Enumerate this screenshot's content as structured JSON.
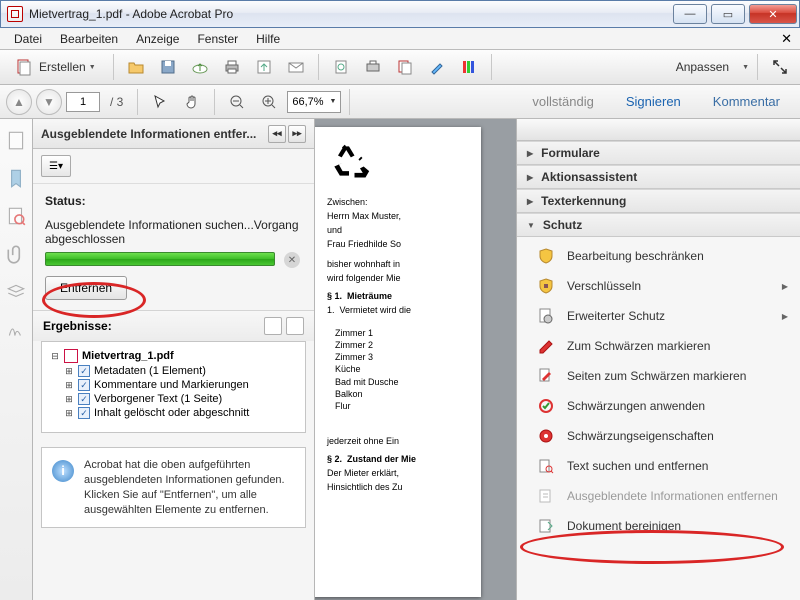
{
  "window": {
    "title": "Mietvertrag_1.pdf - Adobe Acrobat Pro"
  },
  "menu": {
    "datei": "Datei",
    "bearbeiten": "Bearbeiten",
    "anzeige": "Anzeige",
    "fenster": "Fenster",
    "hilfe": "Hilfe"
  },
  "toolbar": {
    "erstellen": "Erstellen",
    "anpassen": "Anpassen"
  },
  "nav": {
    "page": "1",
    "total": "/ 3",
    "zoom": "66,7%"
  },
  "tabs": {
    "voll": "vollständig",
    "sign": "Signieren",
    "komm": "Kommentar"
  },
  "panel": {
    "title": "Ausgeblendete Informationen entfer...",
    "status_h": "Status:",
    "status_txt": "Ausgeblendete Informationen suchen...Vorgang abgeschlossen",
    "entfernen": "Entfernen",
    "erg": "Ergebnisse:",
    "file": "Mietvertrag_1.pdf",
    "r1": "Metadaten (1 Element)",
    "r2": "Kommentare und Markierungen",
    "r3": "Verborgener Text (1 Seite)",
    "r4": "Inhalt gelöscht oder abgeschnitt",
    "info": "Acrobat hat die oben aufgeführten ausgeblendeten Informationen gefunden. Klicken Sie auf \"Entfernen\", um alle ausgewählten Elemente zu entfernen."
  },
  "doc": {
    "zw": "Zwischen:",
    "p1": "Herrn Max Muster,",
    "und": "und",
    "p2": " Frau Friedhilde So",
    "p3": "bisher wohnhaft in",
    "p4": "wird folgender Mie",
    "s1": "§ 1.",
    "s1t": "Mieträume",
    "s1n": "1.",
    "s1x": "Vermietet wird die",
    "z1": "Zimmer 1",
    "z2": "Zimmer 2",
    "z3": "Zimmer 3",
    "z4": "Küche",
    "z5": "Bad mit Dusche",
    "z6": "Balkon",
    "z7": "Flur",
    "jz": "jederzeit ohne Ein",
    "s2": "§ 2.",
    "s2t": "Zustand der Mie",
    "s2x": "Der Mieter erklärt,",
    "s2y": "Hinsichtlich des Zu"
  },
  "right": {
    "formulare": "Formulare",
    "aktion": "Aktionsassistent",
    "texterk": "Texterkennung",
    "schutz": "Schutz",
    "t1": "Bearbeitung beschränken",
    "t2": "Verschlüsseln",
    "t3": "Erweiterter Schutz",
    "t4": "Zum Schwärzen markieren",
    "t5": "Seiten zum Schwärzen markieren",
    "t6": "Schwärzungen anwenden",
    "t7": "Schwärzungseigenschaften",
    "t8": "Text suchen und entfernen",
    "t9": "Ausgeblendete Informationen entfernen",
    "t10": "Dokument bereinigen"
  }
}
